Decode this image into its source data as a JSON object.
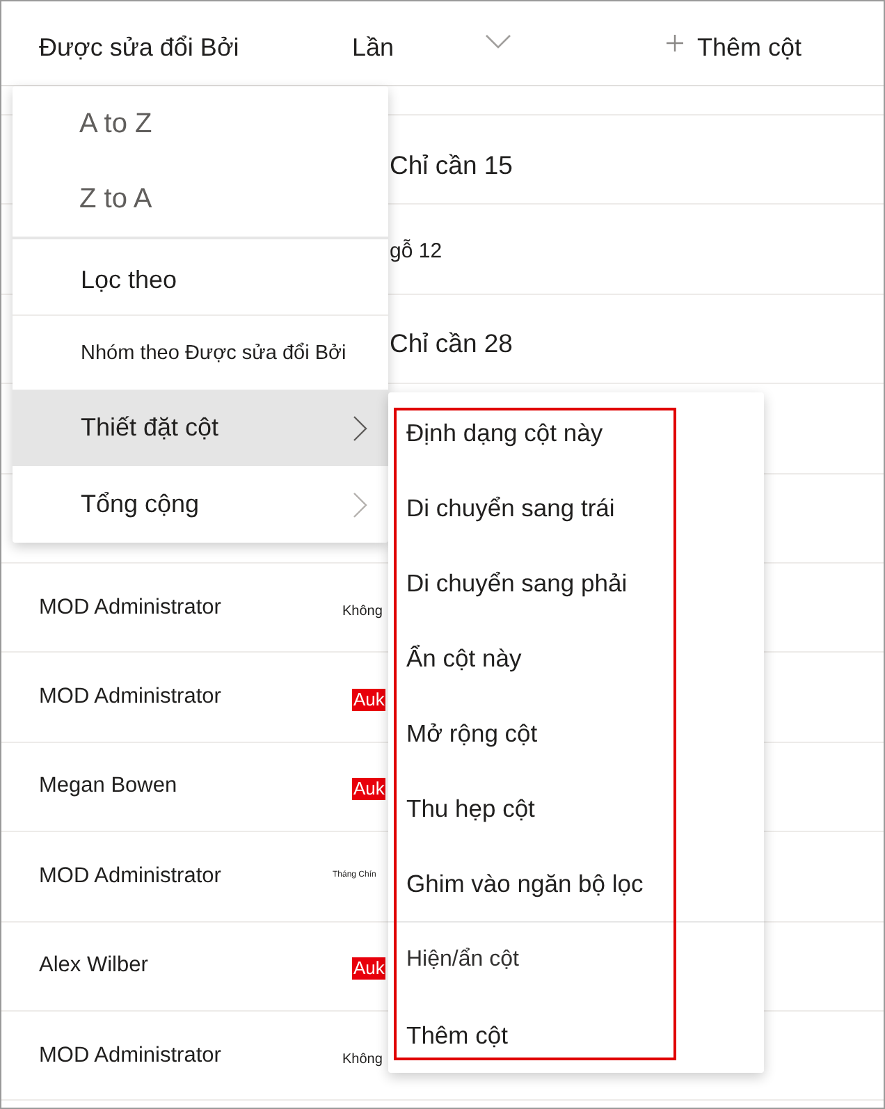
{
  "table": {
    "columns": [
      {
        "label": "Được sửa đổi Bởi",
        "kind": "plain"
      },
      {
        "label": "Lần",
        "kind": "dropdown"
      },
      {
        "label": "Thêm cột",
        "kind": "add"
      }
    ],
    "rows": [
      {
        "value": "Chỉ cần 15",
        "kind": "large"
      },
      {
        "value": "gỗ 12",
        "kind": "plain"
      },
      {
        "value": "Chỉ cần 28",
        "kind": "large"
      },
      {},
      {},
      {
        "modified_by": "MOD Administrator",
        "value": "Không",
        "kind": "note"
      },
      {
        "modified_by": "MOD Administrator",
        "value": "Auk",
        "kind": "tag"
      },
      {
        "modified_by": "Megan Bowen",
        "value": "Auk",
        "kind": "tag"
      },
      {
        "modified_by": "MOD Administrator",
        "value": "Tháng Chín",
        "kind": "micro"
      },
      {
        "modified_by": "Alex Wilber",
        "value": "Auk",
        "kind": "tag"
      },
      {
        "modified_by": "MOD Administrator",
        "value": "Không",
        "kind": "note"
      }
    ]
  },
  "column_menu": {
    "items": [
      {
        "label": "A to Z",
        "kind": "sort",
        "selected": false
      },
      {
        "label": "Z to A",
        "kind": "sort",
        "selected": false
      },
      {
        "label": "Lọc theo",
        "kind": "action",
        "selected": false
      },
      {
        "label": "Nhóm theo Được sửa đổi Bởi",
        "kind": "option",
        "selected": false
      },
      {
        "label": "Thiết đặt cột",
        "kind": "submenu",
        "selected": true
      },
      {
        "label": "Tổng cộng",
        "kind": "submenu",
        "selected": false
      }
    ]
  },
  "column_settings_menu": {
    "items": [
      {
        "label": "Định dạng cột này",
        "kind": "action",
        "selected": false
      },
      {
        "label": "Di chuyển sang trái",
        "kind": "action",
        "selected": false
      },
      {
        "label": "Di chuyển sang phải",
        "kind": "action",
        "selected": false
      },
      {
        "label": "Ẩn cột này",
        "kind": "action",
        "selected": false
      },
      {
        "label": "Mở rộng cột",
        "kind": "action",
        "selected": false
      },
      {
        "label": "Thu hẹp cột",
        "kind": "action",
        "selected": false
      },
      {
        "label": "Ghim vào ngăn bộ lọc",
        "kind": "action",
        "selected": false
      },
      {
        "label": "Hiện/ẩn cột",
        "kind": "view",
        "selected": false
      },
      {
        "label": "Thêm cột",
        "kind": "action",
        "selected": false
      }
    ]
  }
}
